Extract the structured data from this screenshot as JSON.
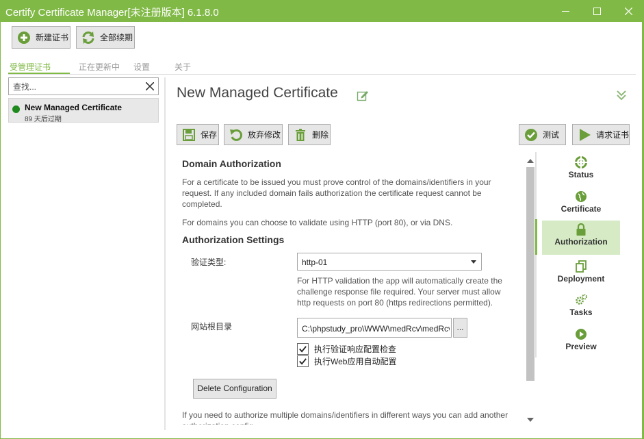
{
  "window": {
    "title": "Certify Certificate Manager[未注册版本] 6.1.8.0",
    "accent": "#80b946"
  },
  "toolbar": {
    "new_cert": "新建证书",
    "renew_all": "全部续期"
  },
  "tabs": [
    {
      "label": "受管理证书",
      "active": true
    },
    {
      "label": "正在更新中",
      "active": false
    },
    {
      "label": "设置",
      "active": false
    },
    {
      "label": "关于",
      "active": false
    }
  ],
  "search": {
    "placeholder": "查找...",
    "value": ""
  },
  "cert_list": [
    {
      "name": "New Managed Certificate",
      "expiry": "89 天后过期",
      "status_color": "#1e8a1e"
    }
  ],
  "main": {
    "title": "New Managed Certificate",
    "actions": {
      "save": "保存",
      "discard": "放弃修改",
      "delete": "删除",
      "test": "测试",
      "request": "请求证书"
    }
  },
  "auth": {
    "heading": "Domain Authorization",
    "intro": "For a certificate to be issued you must prove control of the domains/identifiers in your request. If any included domain fails authorization the certificate request cannot be completed.",
    "intro2": "For domains you can choose to validate using HTTP (port 80), or via DNS.",
    "settings_heading": "Authorization Settings",
    "type_label": "验证类型:",
    "type_value": "http-01",
    "type_help": "For HTTP validation the app will automatically create the challenge response file required. Your server must allow http requests on port 80 (https redirections permitted).",
    "root_label": "网站根目录",
    "root_value": "C:\\phpstudy_pro\\WWW\\medRcv\\medRcv",
    "browse_label": "...",
    "check1": "执行验证响应配置检查",
    "check2": "执行Web应用自动配置",
    "check1_checked": true,
    "check2_checked": true,
    "delete_config": "Delete Configuration",
    "footer": "If you need to authorize multiple domains/identifiers in different ways you can add another authorization config."
  },
  "sidenav": [
    {
      "label": "Status",
      "icon": "lifebuoy-icon",
      "active": false
    },
    {
      "label": "Certificate",
      "icon": "globe-icon",
      "active": false
    },
    {
      "label": "Authorization",
      "icon": "lock-icon",
      "active": true
    },
    {
      "label": "Deployment",
      "icon": "copy-icon",
      "active": false
    },
    {
      "label": "Tasks",
      "icon": "gears-icon",
      "active": false
    },
    {
      "label": "Preview",
      "icon": "play-circle-icon",
      "active": false
    }
  ]
}
